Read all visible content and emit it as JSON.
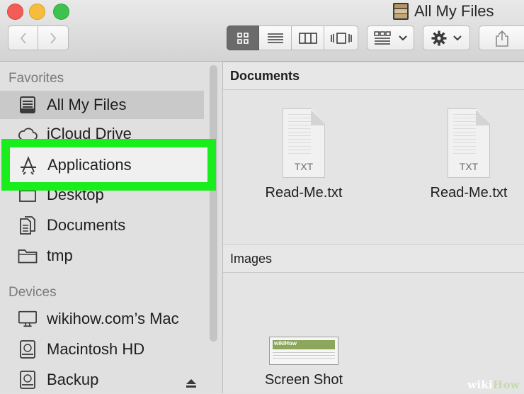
{
  "window": {
    "title": "All My Files"
  },
  "sidebar": {
    "favorites_header": "Favorites",
    "devices_header": "Devices",
    "favorites": [
      {
        "label": "All My Files",
        "icon": "all-my-files-icon"
      },
      {
        "label": "iCloud Drive",
        "icon": "cloud-icon"
      },
      {
        "label": "Applications",
        "icon": "applications-icon"
      },
      {
        "label": "Desktop",
        "icon": "desktop-icon"
      },
      {
        "label": "Documents",
        "icon": "documents-icon"
      },
      {
        "label": "tmp",
        "icon": "folder-icon"
      }
    ],
    "devices": [
      {
        "label": "wikihow.com’s Mac",
        "icon": "computer-icon"
      },
      {
        "label": "Macintosh HD",
        "icon": "hard-drive-icon"
      },
      {
        "label": "Backup",
        "icon": "hard-drive-icon"
      }
    ]
  },
  "content": {
    "groups": [
      {
        "name": "Documents",
        "files": [
          {
            "name": "Read-Me.txt",
            "ext": "TXT"
          },
          {
            "name": "Read-Me.txt",
            "ext": "TXT"
          }
        ]
      },
      {
        "name": "Images",
        "files": [
          {
            "name": "Screen Shot",
            "thumb_logo": "wikiHow"
          }
        ]
      }
    ]
  },
  "watermark": {
    "wiki": "wiki",
    "how": "How"
  },
  "colors": {
    "highlight": "#19ee1c",
    "selected": "#c9c9c9",
    "sidebar": "#e0e0e0"
  }
}
